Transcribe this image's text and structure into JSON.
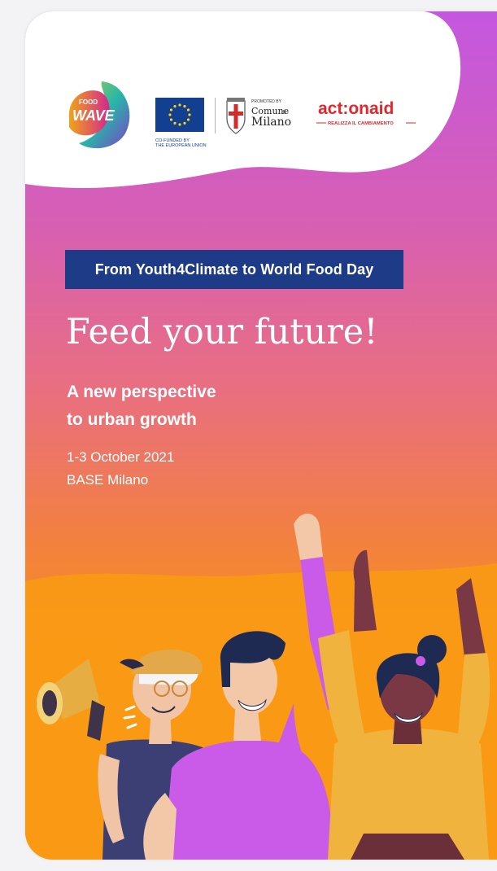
{
  "logos": {
    "food_wave": {
      "line1": "FOOD",
      "line2": "WAVE"
    },
    "eu": {
      "caption_line1": "CO-FUNDED BY",
      "caption_line2": "THE EUROPEAN UNION"
    },
    "milano": {
      "promoted": "PROMOTED BY",
      "line1": "Comune",
      "line1_suffix": "di",
      "line2": "Milano"
    },
    "actionaid": {
      "name": "act:onaid",
      "tagline": "REALIZZA IL CAMBIAMENTO"
    }
  },
  "banner": {
    "text": "From Youth4Climate to World Food Day"
  },
  "headline": {
    "text": "Feed your future!"
  },
  "subline": {
    "line1": "A new perspective",
    "line2": "to urban growth"
  },
  "event": {
    "date": "1-3 October 2021",
    "venue": "BASE Milano"
  },
  "colors": {
    "banner_bg": "#1d3b86",
    "gradient_top": "#c457e0",
    "gradient_bottom": "#f9951a",
    "actionaid_red": "#e2262b"
  },
  "icons": [
    "megaphone-icon",
    "eu-flag-icon",
    "milano-crest-icon"
  ]
}
